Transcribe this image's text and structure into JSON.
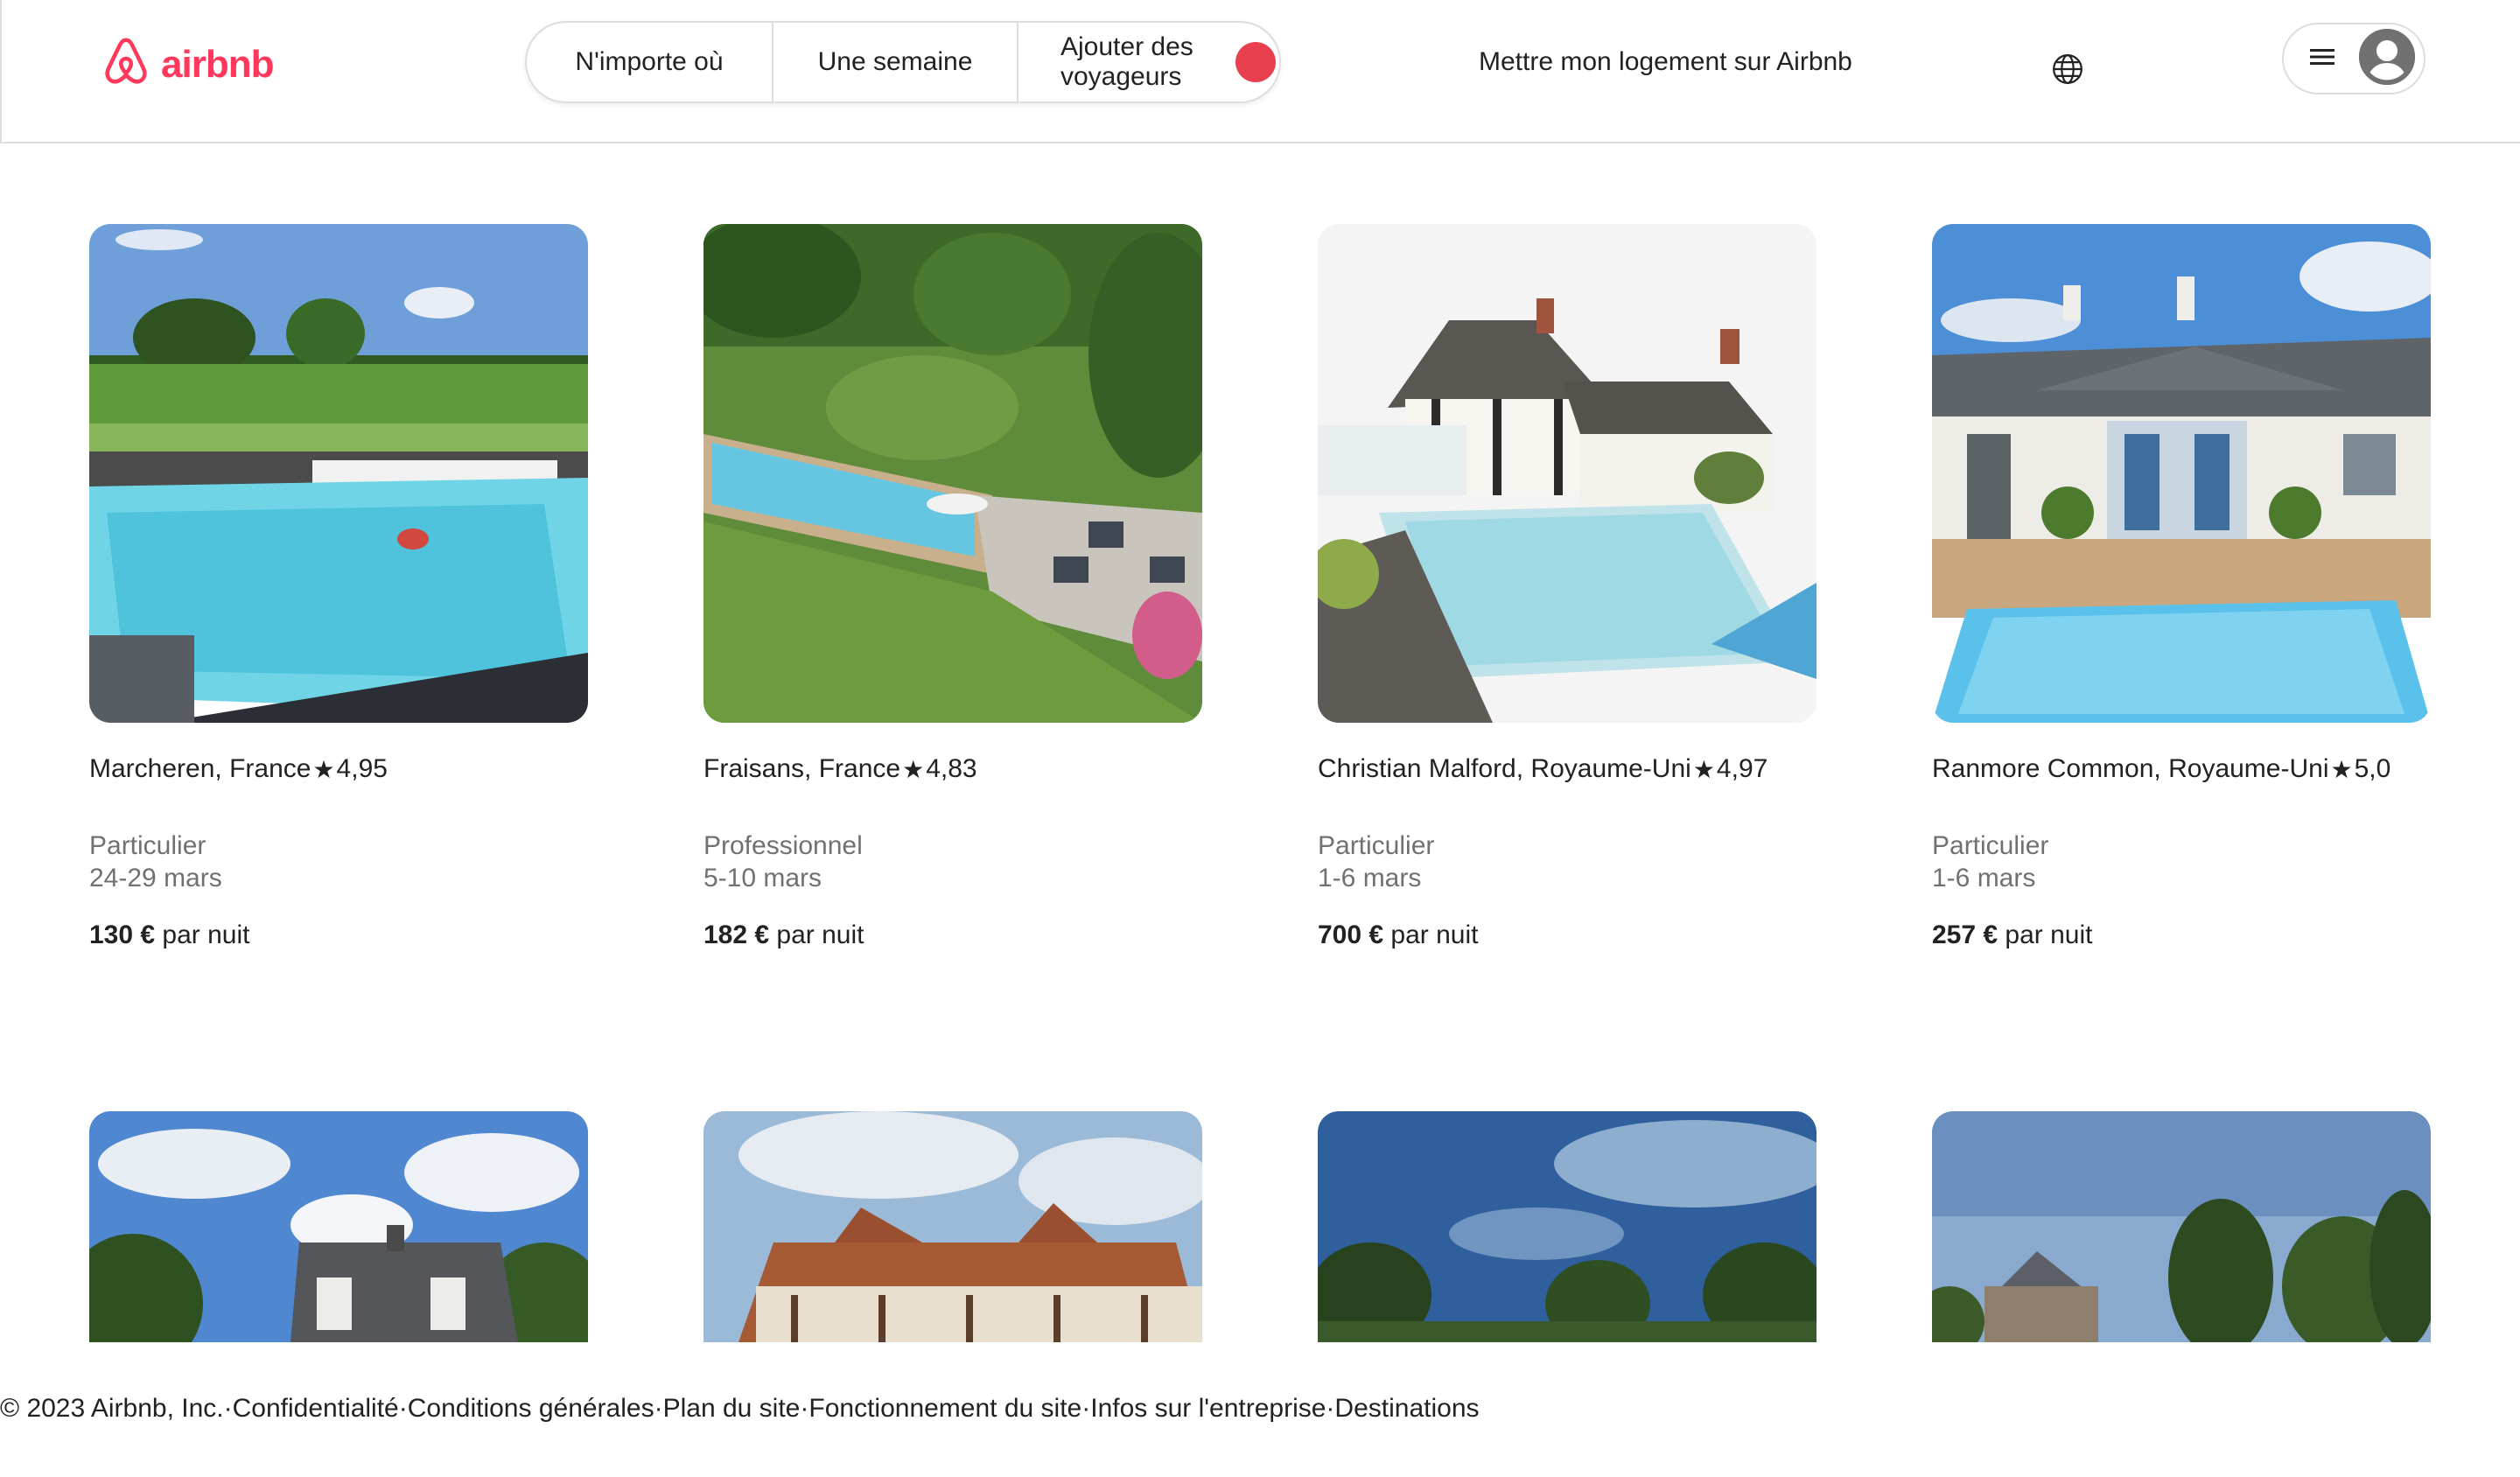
{
  "header": {
    "logo_text": "airbnb",
    "search": {
      "anywhere": "N'importe où",
      "week": "Une semaine",
      "guests": "Ajouter des voyageurs"
    },
    "host_link": "Mettre mon logement sur Airbnb",
    "colors": {
      "brand": "#FF385C",
      "search_button": "#E8404F"
    }
  },
  "listings": [
    {
      "location": "Marcheren, France",
      "rating": "4,95",
      "host_type": "Particulier",
      "dates": "24-29 mars",
      "price": "130 €",
      "price_suffix": "par nuit"
    },
    {
      "location": "Fraisans, France",
      "rating": "4,83",
      "host_type": "Professionnel",
      "dates": "5-10 mars",
      "price": "182 €",
      "price_suffix": "par nuit"
    },
    {
      "location": "Christian Malford, Royaume-Uni",
      "rating": "4,97",
      "host_type": "Particulier",
      "dates": "1-6 mars",
      "price": "700 €",
      "price_suffix": "par nuit"
    },
    {
      "location": "Ranmore Common, Royaume-Uni",
      "rating": "5,0",
      "host_type": "Particulier",
      "dates": "1-6 mars",
      "price": "257 €",
      "price_suffix": "par nuit"
    }
  ],
  "footer": {
    "copyright": "© 2023 Airbnb, Inc.",
    "links": [
      "Confidentialité",
      "Conditions générales",
      "Plan du site",
      "Fonctionnement du site",
      "Infos sur l'entreprise",
      "Destinations"
    ],
    "separator": "·"
  }
}
